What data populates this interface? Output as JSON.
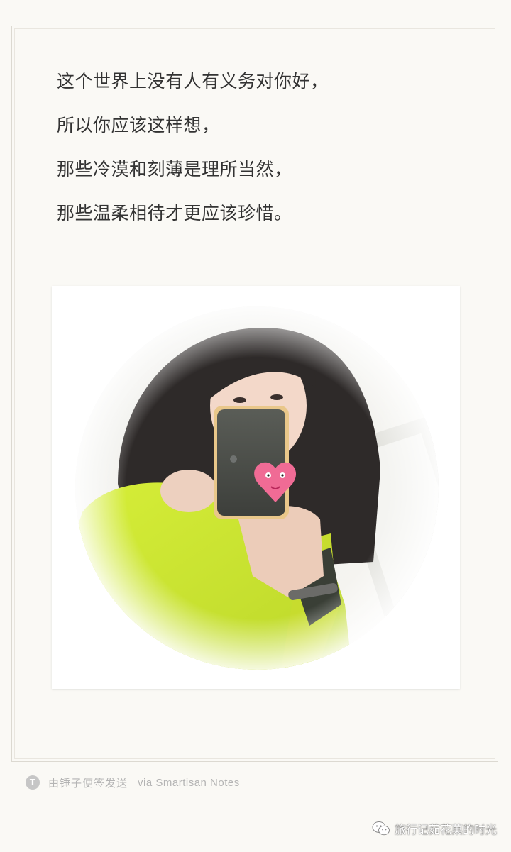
{
  "note": {
    "lines": [
      "这个世界上没有人有义务对你好，",
      "所以你应该这样想，",
      "那些冷漠和刻薄是理所当然，",
      "那些温柔相待才更应该珍惜。"
    ]
  },
  "photo": {
    "icon": "circular-selfie-photo"
  },
  "footer": {
    "logo_letter": "T",
    "sent_text": "由锤子便签发送",
    "via_text": "via Smartisan Notes"
  },
  "watermark": {
    "icon": "wechat-icon",
    "text": "旅行记茹花菓的时光"
  },
  "colors": {
    "background": "#faf9f5",
    "text": "#333333",
    "footer_text": "#b4b4b4"
  }
}
